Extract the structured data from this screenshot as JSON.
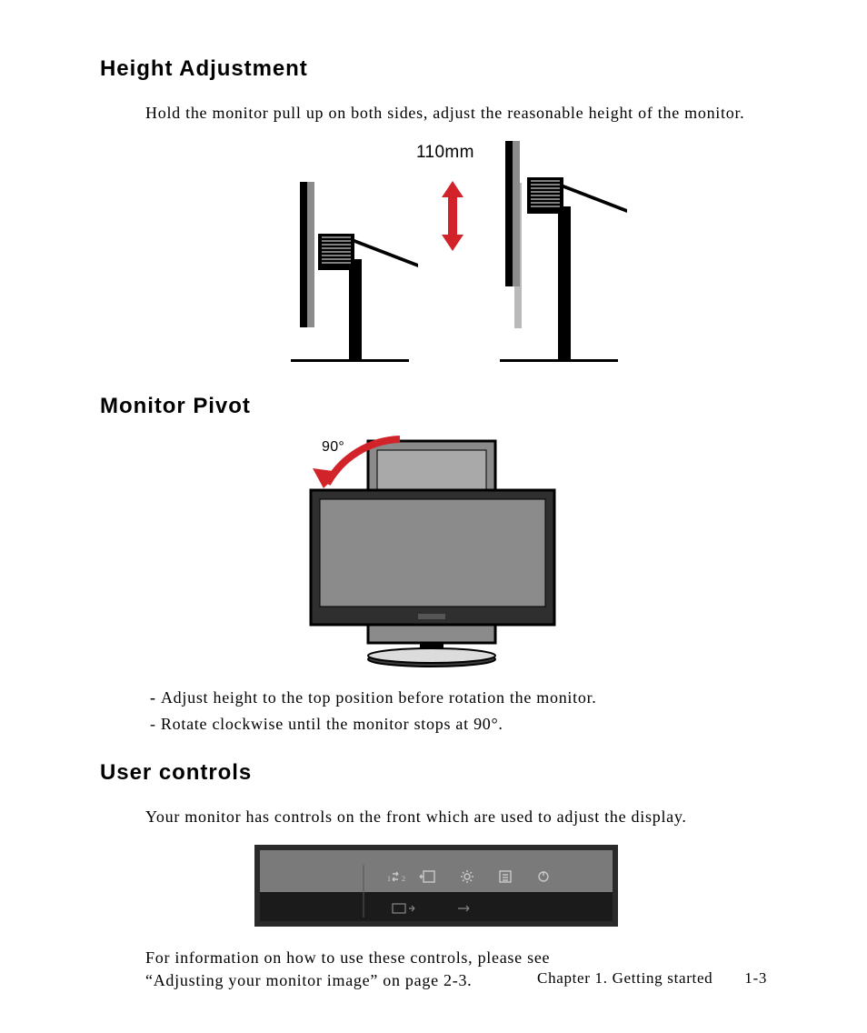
{
  "section1": {
    "heading": "Height Adjustment",
    "intro": "Hold the monitor pull up on both sides, adjust the reasonable height of the monitor.",
    "fig_label": "110mm"
  },
  "section2": {
    "heading": "Monitor Pivot",
    "fig_label": "90°",
    "bullet1": "Adjust height to the top position before rotation the monitor.",
    "bullet2": "- Rotate clockwise until the monitor stops at 90°."
  },
  "section3": {
    "heading": "User controls",
    "intro": "Your monitor has controls on the front which are used to adjust the display.",
    "note_line1": "For information on how to use these controls, please see",
    "note_line2": "“Adjusting your monitor image” on page 2-3."
  },
  "footer": {
    "chapter": "Chapter 1. Getting started",
    "page": "1-3"
  },
  "colors": {
    "accent": "#d2232a",
    "mid_gray": "#8b8b8b",
    "dark_gray": "#3b3b3b",
    "light_gray": "#b9b9b9"
  }
}
